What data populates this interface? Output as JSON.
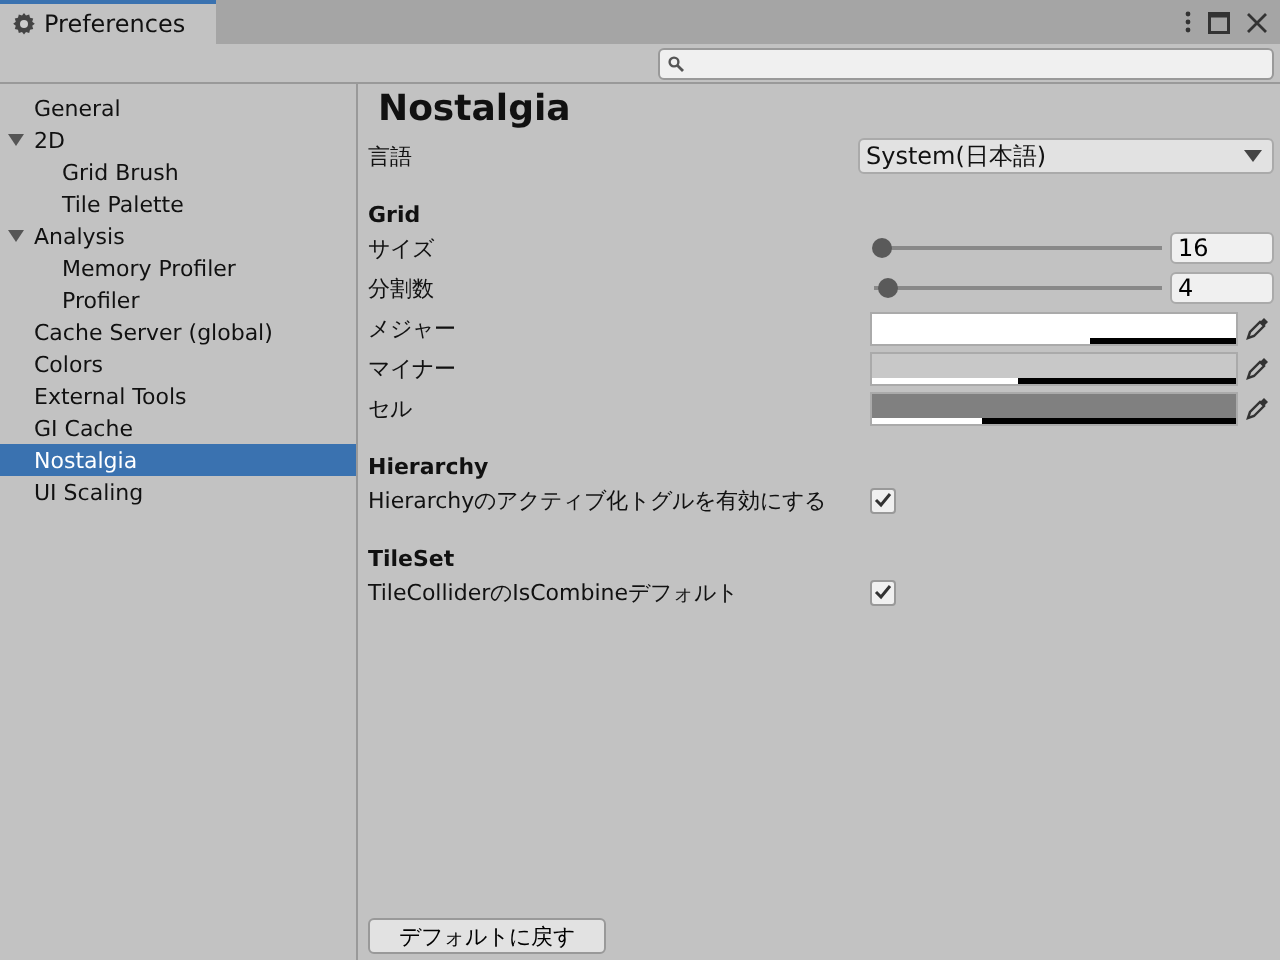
{
  "window": {
    "tab_title": "Preferences"
  },
  "sidebar": {
    "items": [
      {
        "label": "General",
        "selected": false
      },
      {
        "label": "2D",
        "selected": false,
        "expanded": true,
        "children": [
          {
            "label": "Grid Brush",
            "selected": false
          },
          {
            "label": "Tile Palette",
            "selected": false
          }
        ]
      },
      {
        "label": "Analysis",
        "selected": false,
        "expanded": true,
        "children": [
          {
            "label": "Memory Profiler",
            "selected": false
          },
          {
            "label": "Profiler",
            "selected": false
          }
        ]
      },
      {
        "label": "Cache Server (global)",
        "selected": false
      },
      {
        "label": "Colors",
        "selected": false
      },
      {
        "label": "External Tools",
        "selected": false
      },
      {
        "label": "GI Cache",
        "selected": false
      },
      {
        "label": "Nostalgia",
        "selected": true
      },
      {
        "label": "UI Scaling",
        "selected": false
      }
    ]
  },
  "content": {
    "title": "Nostalgia",
    "rows": [
      {
        "kind": "dropdown",
        "label": "言語",
        "value": "System(日本語)"
      },
      {
        "kind": "header",
        "label": "Grid"
      },
      {
        "kind": "slider",
        "label": "サイズ",
        "level": 0.03,
        "value": "16"
      },
      {
        "kind": "slider",
        "label": "分割数",
        "level": 0.05,
        "value": "4"
      },
      {
        "kind": "color",
        "label": "メジャー",
        "color": "#ffffff",
        "level": 0.6
      },
      {
        "kind": "color",
        "label": "マイナー",
        "color": "#c8c8c8",
        "level": 0.4
      },
      {
        "kind": "color",
        "label": "セル",
        "color": "#808080",
        "level": 0.3
      },
      {
        "kind": "header",
        "label": "Hierarchy"
      },
      {
        "kind": "toggle",
        "label": "Hierarchyのアクティブ化トグルを有効にする",
        "checked": true
      },
      {
        "kind": "header",
        "label": "TileSet"
      },
      {
        "kind": "toggle",
        "label": "TileColliderのIsCombineデフォルト",
        "checked": true
      }
    ],
    "reset_button": "デフォルトに戻す"
  }
}
